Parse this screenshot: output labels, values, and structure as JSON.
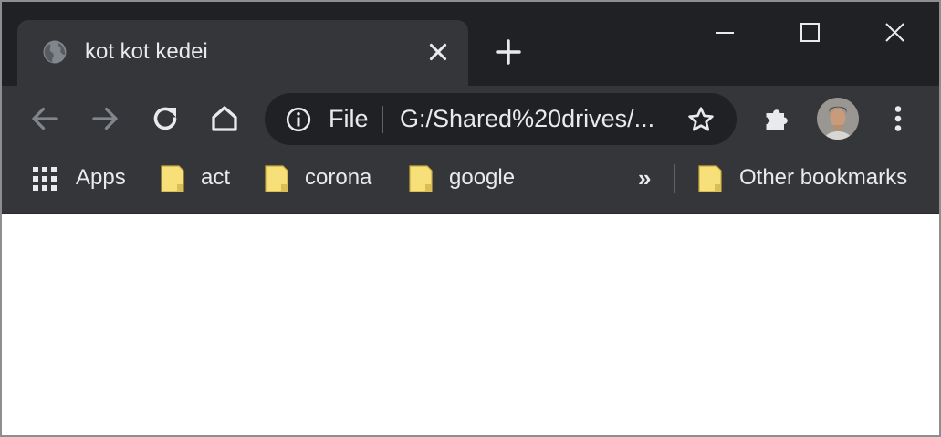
{
  "colors": {
    "titlebar": "#202124",
    "tab_active": "#35363a",
    "toolbar": "#35363a",
    "omnibox": "#202124",
    "text": "#e8eaed",
    "icon": "#e8eaed",
    "icon_disabled": "#80868b",
    "folder": "#f7e07a"
  },
  "tab": {
    "title": "kot kot kedei",
    "favicon": "globe-icon",
    "close_icon": "close-icon"
  },
  "new_tab_icon": "plus-icon",
  "window_controls": [
    "minimize-icon",
    "maximize-icon",
    "close-icon"
  ],
  "toolbar": {
    "back_icon": "arrow-left-icon",
    "forward_icon": "arrow-right-icon",
    "reload_icon": "reload-icon",
    "home_icon": "home-icon",
    "extensions_icon": "puzzle-icon",
    "menu_icon": "more-vert-icon"
  },
  "omnibox": {
    "info_icon": "info-icon",
    "scheme": "File",
    "url": "G:/Shared%20drives/...",
    "bookmark_icon": "star-icon"
  },
  "bookmarks": {
    "apps_label": "Apps",
    "items": [
      {
        "label": "act",
        "icon": "folder-icon"
      },
      {
        "label": "corona",
        "icon": "folder-icon"
      },
      {
        "label": "google",
        "icon": "folder-icon"
      }
    ],
    "overflow": "»",
    "other_label": "Other bookmarks"
  }
}
